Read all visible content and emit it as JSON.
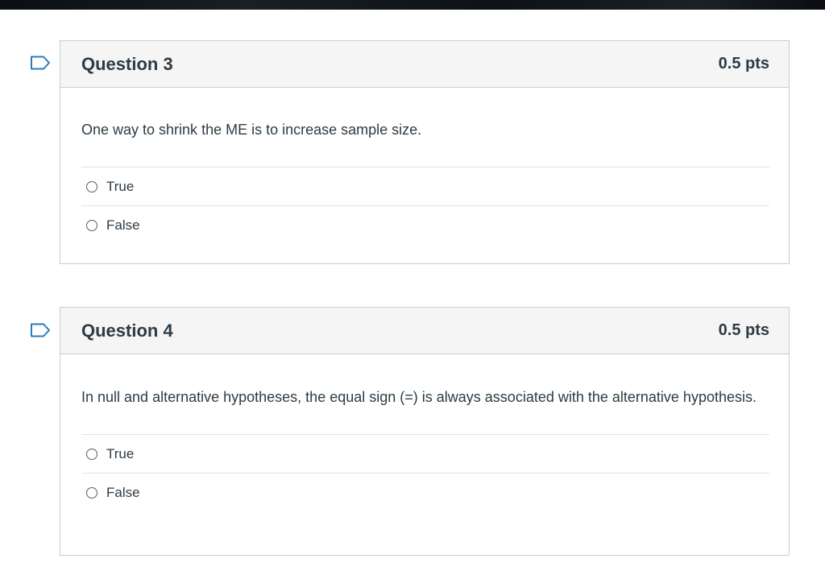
{
  "questions": [
    {
      "title": "Question 3",
      "points": "0.5 pts",
      "text": "One way to shrink the ME is to increase sample size.",
      "answers": [
        {
          "label": "True"
        },
        {
          "label": "False"
        }
      ]
    },
    {
      "title": "Question 4",
      "points": "0.5 pts",
      "text": "In null and alternative hypotheses, the equal sign (=) is always associated with the alternative hypothesis.",
      "answers": [
        {
          "label": "True"
        },
        {
          "label": "False"
        }
      ]
    }
  ],
  "icons": {
    "flag": "flag-question-icon",
    "radio": "radio-empty-icon"
  },
  "colors": {
    "header_bg": "#f5f5f5",
    "border": "#c7cdd1",
    "text": "#2d3b45",
    "flag_stroke": "#2b7abc"
  }
}
